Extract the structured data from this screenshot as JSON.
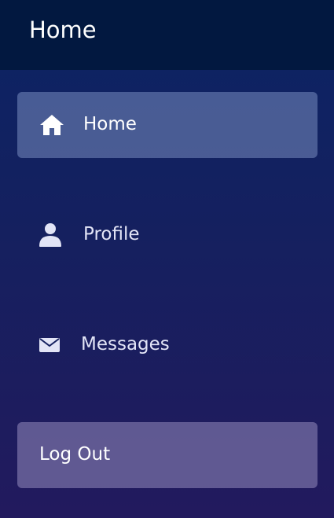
{
  "header": {
    "title": "Home"
  },
  "nav": {
    "items": [
      {
        "label": "Home",
        "icon": "home-icon",
        "active": true
      },
      {
        "label": "Profile",
        "icon": "user-icon",
        "active": false
      },
      {
        "label": "Messages",
        "icon": "envelope-icon",
        "active": false
      }
    ],
    "logout_label": "Log Out"
  },
  "colors": {
    "header_bg": "#021840",
    "gradient_top": "#0b2464",
    "gradient_bottom": "#221a5e",
    "active_item_bg": "#4c5c8f",
    "logout_bg": "#575180",
    "text": "#ffffff"
  }
}
